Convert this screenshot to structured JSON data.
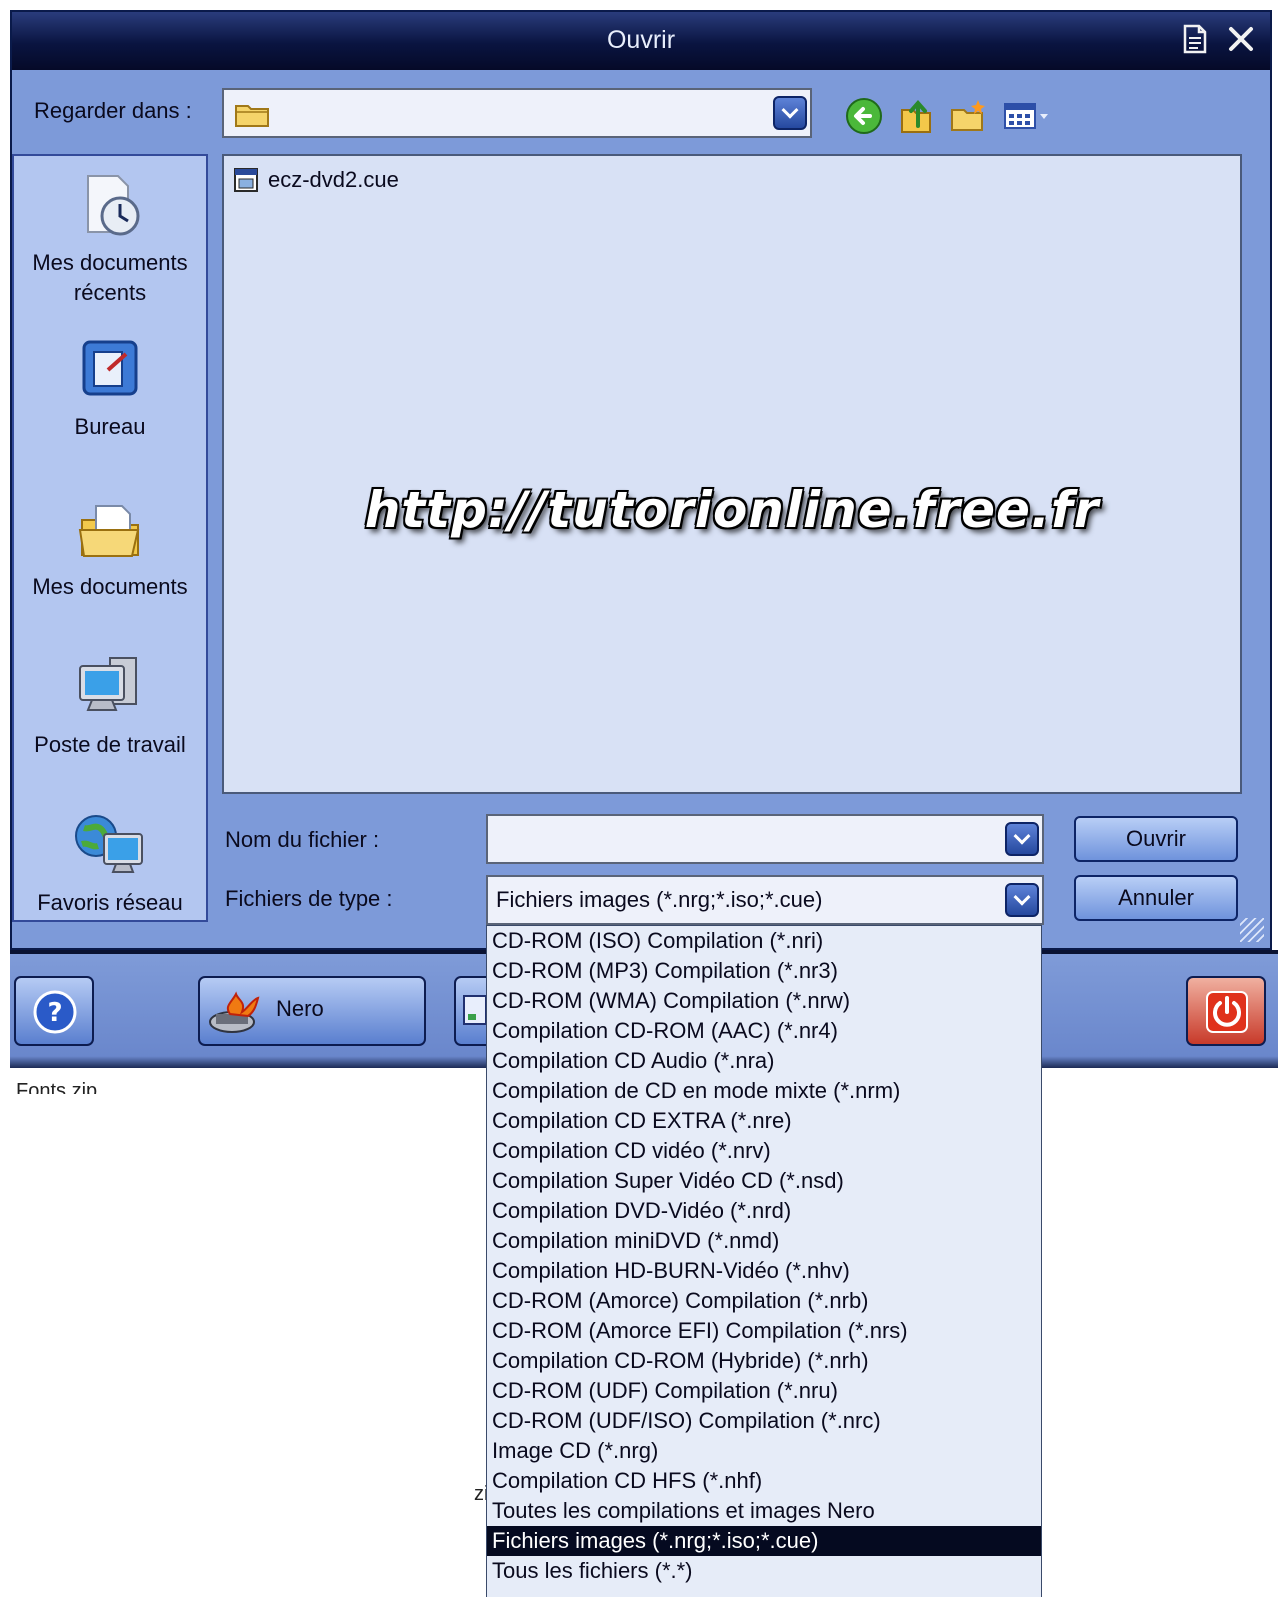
{
  "dialog": {
    "title": "Ouvrir",
    "look_in_label": "Regarder dans :",
    "look_in_value": "",
    "filename_label": "Nom du fichier :",
    "filename_value": "",
    "filetype_label": "Fichiers de type :",
    "filetype_value": "Fichiers images (*.nrg;*.iso;*.cue)",
    "open_button": "Ouvrir",
    "cancel_button": "Annuler"
  },
  "places": [
    {
      "label": "Mes documents récents",
      "icon": "recent-documents-icon"
    },
    {
      "label": "Bureau",
      "icon": "desktop-icon"
    },
    {
      "label": "Mes documents",
      "icon": "my-documents-icon"
    },
    {
      "label": "Poste de travail",
      "icon": "my-computer-icon"
    },
    {
      "label": "Favoris réseau",
      "icon": "network-places-icon"
    }
  ],
  "files": [
    {
      "name": "ecz-dvd2.cue",
      "icon": "cue-file-icon"
    }
  ],
  "watermark": "http://tutorionline.free.fr",
  "toolbar": {
    "nero_label": "Nero",
    "stray_text_left": "Fonts.zip",
    "stray_text_mid": "zi"
  },
  "filetype_options": [
    "CD-ROM (ISO) Compilation (*.nri)",
    "CD-ROM (MP3) Compilation (*.nr3)",
    "CD-ROM (WMA) Compilation (*.nrw)",
    "Compilation CD-ROM (AAC) (*.nr4)",
    "Compilation CD Audio (*.nra)",
    "Compilation de CD en mode mixte (*.nrm)",
    "Compilation CD EXTRA (*.nre)",
    "Compilation CD vidéo (*.nrv)",
    "Compilation Super Vidéo CD (*.nsd)",
    "Compilation DVD-Vidéo (*.nrd)",
    "Compilation miniDVD (*.nmd)",
    "Compilation HD-BURN-Vidéo (*.nhv)",
    "CD-ROM (Amorce) Compilation (*.nrb)",
    "CD-ROM (Amorce EFI) Compilation (*.nrs)",
    "Compilation CD-ROM (Hybride) (*.nrh)",
    "CD-ROM (UDF) Compilation (*.nru)",
    "CD-ROM (UDF/ISO) Compilation (*.nrc)",
    "Image CD (*.nrg)",
    "Compilation CD HFS (*.nhf)",
    "Toutes les compilations et images Nero",
    "Fichiers images (*.nrg;*.iso;*.cue)",
    "Tous les fichiers (*.*)"
  ],
  "selected_option_index": 20,
  "colors": {
    "dialog_bg": "#7d9ad9",
    "titlebar": "#0a1440",
    "selection": "#050a20"
  }
}
